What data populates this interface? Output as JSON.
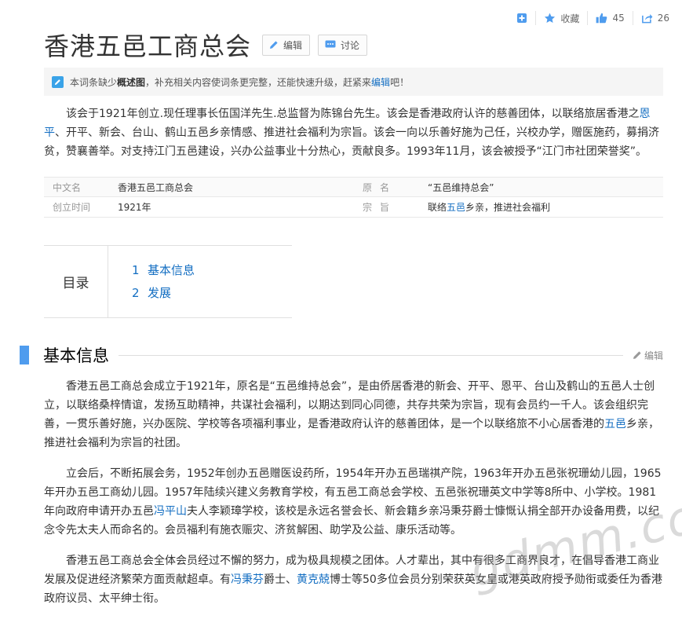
{
  "toolbar": {
    "add_icon": "plus-square-icon",
    "favorite_label": "收藏",
    "like_count": "45",
    "share_count": "26"
  },
  "title": {
    "text": "香港五邑工商总会",
    "edit_label": "编辑",
    "discuss_label": "讨论"
  },
  "notice": {
    "pre": "本词条缺少",
    "bold": "概述图",
    "mid": "，补充相关内容使词条更完整，还能快速升级，赶紧来",
    "link": "编辑",
    "post": "吧！"
  },
  "summary": {
    "p1_a": "该会于1921年创立.现任理事长伍国洋先生.总监督为陈锦台先生。该会是香港政府认许的慈善团体，以联络旅居香港之",
    "p1_link": "恩平",
    "p1_b": "、开平、新会、台山、鹤山五邑乡亲情感、推进社会福利为宗旨。该会一向以乐善好施为己任，兴校办学，赠医施药，募捐济贫，赞襄善举。对支持江门五邑建设，兴办公益事业十分热心，贡献良多。1993年11月，该会被授予“江门市社团荣誉奖”。"
  },
  "info": {
    "r1_name": "中文名",
    "r1_value": "香港五邑工商总会",
    "r1_name2": "原名",
    "r1_value2": "“五邑维持总会”",
    "r2_name": "创立时间",
    "r2_value": "1921年",
    "r2_name2": "宗旨",
    "r2_value2_a": "联络",
    "r2_value2_link": "五邑",
    "r2_value2_b": "乡亲，推进社会福利"
  },
  "catalog": {
    "title": "目录",
    "items": [
      {
        "num": "1",
        "label": "基本信息"
      },
      {
        "num": "2",
        "label": "发展"
      }
    ]
  },
  "section": {
    "title": "基本信息",
    "edit_label": "编辑"
  },
  "body": {
    "p1_a": "香港五邑工商总会成立于1921年，原名是“五邑维持总会”，是由侨居香港的新会、开平、恩平、台山及鹤山的五邑人士创立，以联络桑梓情谊，发扬互助精神，共谋社会福利，以期达到同心同德，共存共荣为宗旨，现有会员约一千人。该会组织完善，一贯乐善好施，兴办医院、学校等各项福利事业，是香港政府认许的慈善团体，是一个以联络旅不小心居香港的",
    "p1_link": "五邑",
    "p1_b": "乡亲，推进社会福利为宗旨的社团。",
    "p2_a": "立会后，不断拓展会务，1952年创办五邑赠医设药所，1954年开办五邑瑞祺产院，1963年开办五邑张祝珊幼儿园，1965年开办五邑工商幼儿园。1957年陆续兴建义务教育学校，有五邑工商总会学校、五邑张祝珊英文中学等8所中、小学校。1981年向政府申请开办五邑",
    "p2_link": "冯平山",
    "p2_b": "夫人李颖璋学校，该校是永远名誉会长、新会籍乡亲冯秉芬爵士慷慨认捐全部开办设备用费，以纪念令先太夫人而命名的。会员福利有施衣赈灾、济贫解困、助学及公益、康乐活动等。",
    "p3_a": "香港五邑工商总会全体会员经过不懈的努力，成为极具规模之团体。人才辈出，其中有很多工商界良才，在倡导香港工商业发展及促进经济繁荣方面贡献超卓。有",
    "p3_link1": "冯秉芬",
    "p3_mid": "爵士、",
    "p3_link2": "黄克兢",
    "p3_b": "博士等50多位会员分别荣获英女皇或港英政府授予勋衔或委任为香港政府议员、太平绅士衔。"
  },
  "watermark": "gdmm.com",
  "colors": {
    "link": "#136ec2",
    "accent_bar": "#4f9cee",
    "notice_bg": "#f5f5f5"
  }
}
